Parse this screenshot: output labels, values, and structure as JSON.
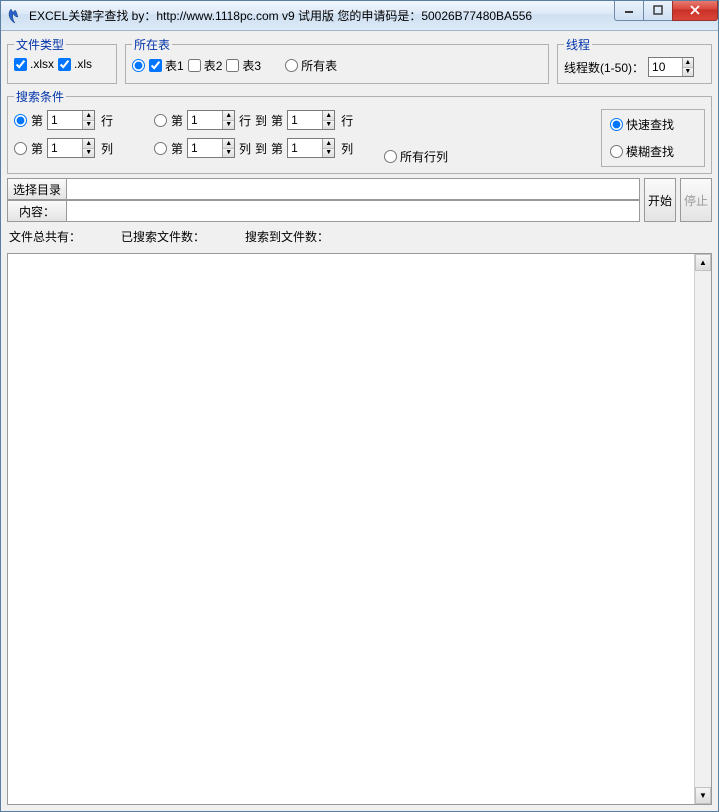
{
  "window": {
    "title": "EXCEL关键字查找  by：http://www.1118pc.com v9 试用版 您的申请码是：50026B77480BA556"
  },
  "filetype": {
    "legend": "文件类型",
    "xlsx_label": ".xlsx",
    "xlsx_checked": true,
    "xls_label": ".xls",
    "xls_checked": true
  },
  "sheet": {
    "legend": "所在表",
    "sheet1_label": "表1",
    "sheet1_checked": true,
    "sheet2_label": "表2",
    "sheet2_checked": false,
    "sheet3_label": "表3",
    "sheet3_checked": false,
    "mode_specific_selected": true,
    "all_label": "所有表",
    "mode_all_selected": false
  },
  "thread": {
    "legend": "线程",
    "label": "线程数(1-50)：",
    "value": "10"
  },
  "search": {
    "legend": "搜索条件",
    "radio_row_single_selected": true,
    "radio_col_single_selected": false,
    "radio_row_range_selected": false,
    "radio_col_range_selected": false,
    "radio_all_selected": false,
    "di": "第",
    "dao": "到",
    "row_suffix": "行",
    "col_suffix": "列",
    "row_single_val": "1",
    "col_single_val": "1",
    "row_range_from": "1",
    "row_range_to": "1",
    "col_range_from": "1",
    "col_range_to": "1",
    "all_label": "所有行列",
    "fast_label": "快速查找",
    "fast_selected": true,
    "fuzzy_label": "模糊查找",
    "fuzzy_selected": false
  },
  "dir": {
    "button": "选择目录",
    "value": ""
  },
  "content": {
    "label": "内容：",
    "value": ""
  },
  "actions": {
    "start": "开始",
    "stop": "停止"
  },
  "status": {
    "total": "文件总共有：",
    "searched": "已搜索文件数：",
    "found": "搜索到文件数："
  }
}
